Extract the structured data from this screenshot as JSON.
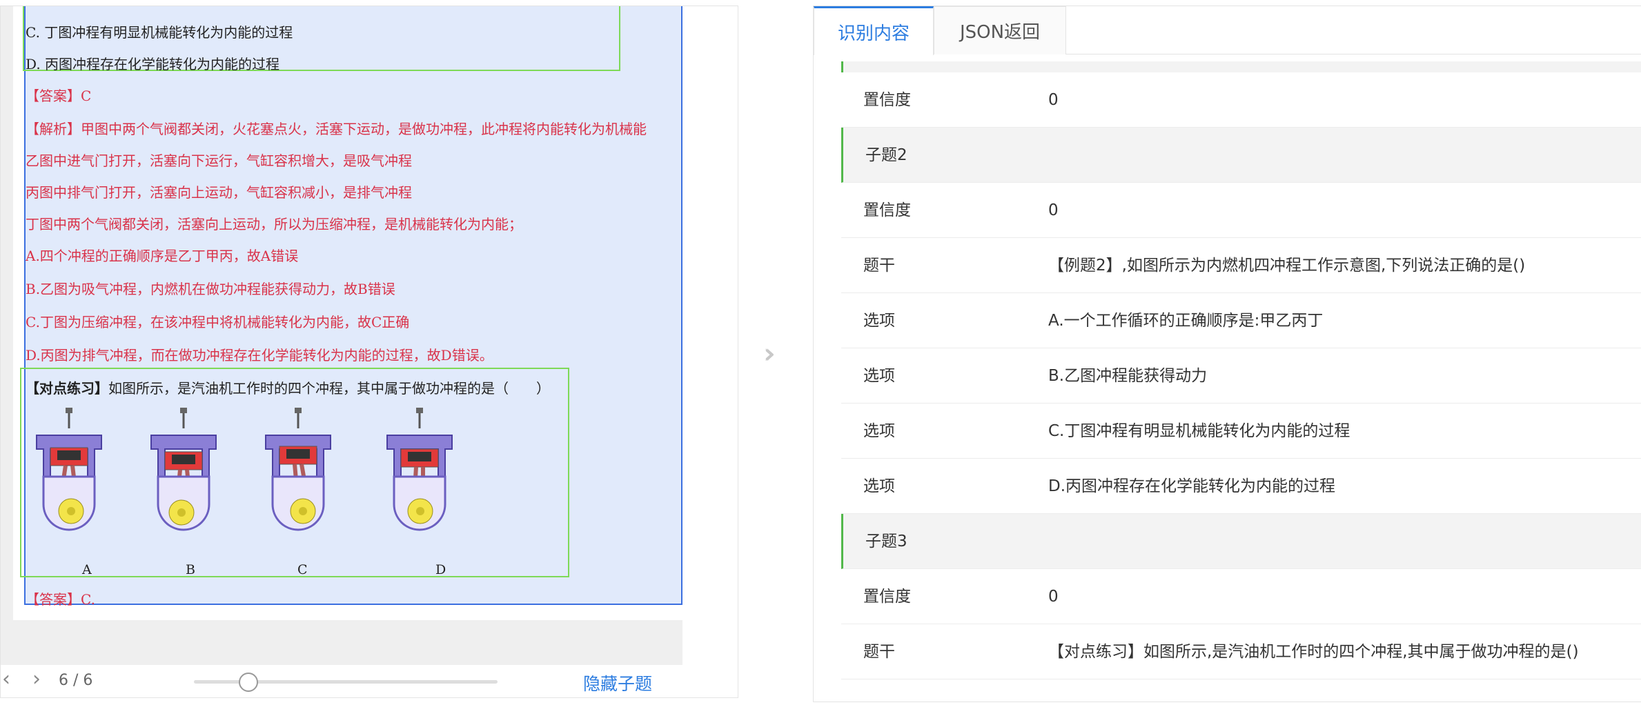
{
  "preview": {
    "lines": [
      {
        "text": "C.   丁图冲程有明显机械能转化为内能的过程",
        "color": "black"
      },
      {
        "text": "D.   丙图冲程存在化学能转化为内能的过程",
        "color": "black"
      },
      {
        "text": "【答案】C",
        "color": "red"
      },
      {
        "text": "【解析】甲图中两个气阀都关闭，火花塞点火，活塞下运动，是做功冲程，此冲程将内能转化为机械能",
        "color": "red"
      },
      {
        "text": "乙图中进气门打开，活塞向下运行，气缸容积增大，是吸气冲程",
        "color": "red"
      },
      {
        "text": "丙图中排气门打开，活塞向上运动，气缸容积减小，是排气冲程",
        "color": "red"
      },
      {
        "text": "丁图中两个气阀都关闭，活塞向上运动，所以为压缩冲程，是机械能转化为内能；",
        "color": "red"
      },
      {
        "text": "A.四个冲程的正确顺序是乙丁甲丙，故A错误",
        "color": "red"
      },
      {
        "text": "B.乙图为吸气冲程，内燃机在做功冲程能获得动力，故B错误",
        "color": "red"
      },
      {
        "text": "C.丁图为压缩冲程，在该冲程中将机械能转化为内能，故C正确",
        "color": "red"
      },
      {
        "text": "D.丙图为排气冲程，而在做功冲程存在化学能转化为内能的过程，故D错误。",
        "color": "red"
      }
    ],
    "practice_bold": "【对点练习】",
    "practice_text": "如图所示，是汽油机工作时的四个冲程，其中属于做功冲程的是（　　）",
    "engine_labels": [
      "A",
      "B",
      "C",
      "D"
    ],
    "answer": "【答案】C."
  },
  "pager": {
    "prev_icon": "chevron-left-icon",
    "next_icon": "chevron-right-icon",
    "page_text": "6 / 6",
    "zoom_fraction": 0.18,
    "hide_label": "隐藏子题"
  },
  "tabs": [
    {
      "label": "识别内容",
      "active": true
    },
    {
      "label": "JSON返回",
      "active": false
    }
  ],
  "results": [
    {
      "type": "field",
      "key": "置信度",
      "value": "0"
    },
    {
      "type": "section",
      "key": "子题2",
      "value": ""
    },
    {
      "type": "field",
      "key": "置信度",
      "value": "0"
    },
    {
      "type": "field",
      "key": "题干",
      "value": "【例题2】,如图所示为内燃机四冲程工作示意图,下列说法正确的是()"
    },
    {
      "type": "field",
      "key": "选项",
      "value": "A.一个工作循环的正确顺序是:甲乙丙丁"
    },
    {
      "type": "field",
      "key": "选项",
      "value": "B.乙图冲程能获得动力"
    },
    {
      "type": "field",
      "key": "选项",
      "value": "C.丁图冲程有明显机械能转化为内能的过程"
    },
    {
      "type": "field",
      "key": "选项",
      "value": "D.丙图冲程存在化学能转化为内能的过程"
    },
    {
      "type": "section",
      "key": "子题3",
      "value": ""
    },
    {
      "type": "field",
      "key": "置信度",
      "value": "0"
    },
    {
      "type": "field",
      "key": "题干",
      "value": "【对点练习】如图所示,是汽油机工作时的四个冲程,其中属于做功冲程的是()"
    }
  ],
  "colors": {
    "accent": "#2d7de0",
    "region_blue": "#3b6fe0",
    "region_green": "#7ed957",
    "answer_red": "#d9334a",
    "section_bar": "#52b84a"
  }
}
